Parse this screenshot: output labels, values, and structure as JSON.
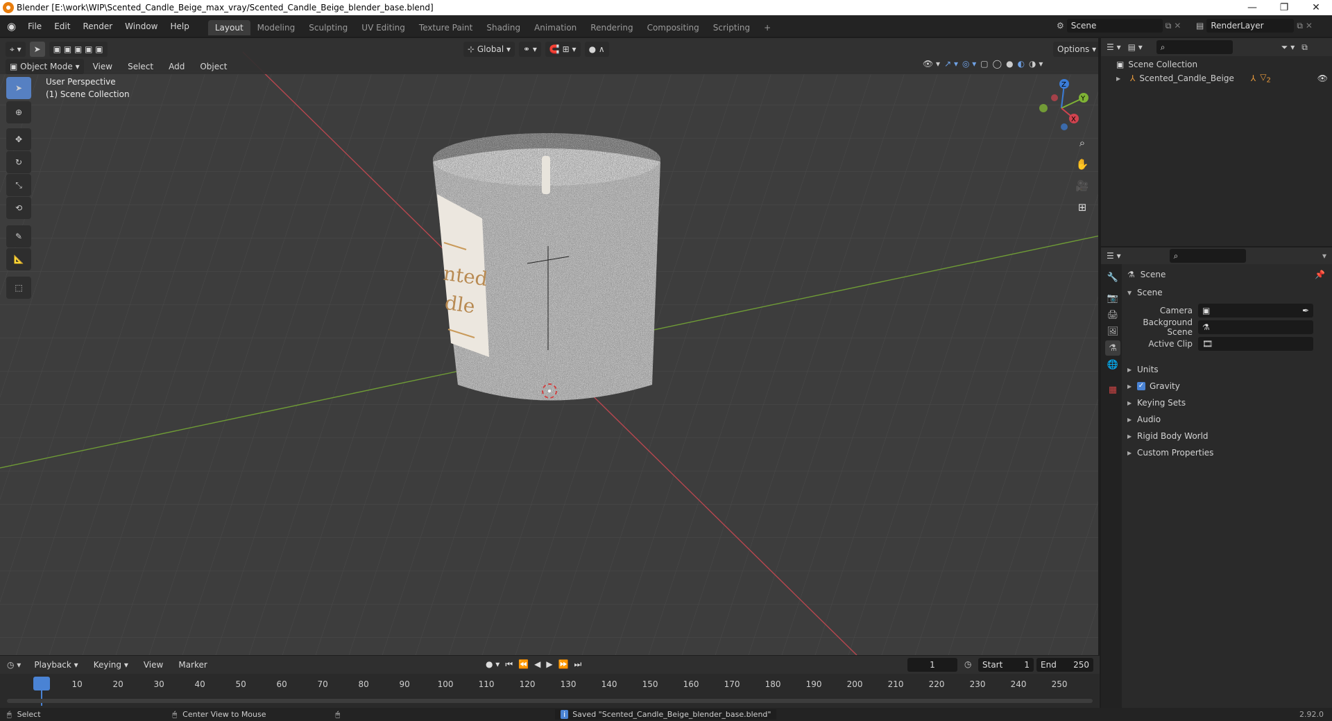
{
  "window": {
    "title": "Blender [E:\\work\\WIP\\Scented_Candle_Beige_max_vray/Scented_Candle_Beige_blender_base.blend]",
    "minimize": "—",
    "maximize": "❐",
    "close": "✕"
  },
  "menu": [
    "File",
    "Edit",
    "Render",
    "Window",
    "Help"
  ],
  "workspaces": [
    "Layout",
    "Modeling",
    "Sculpting",
    "UV Editing",
    "Texture Paint",
    "Shading",
    "Animation",
    "Rendering",
    "Compositing",
    "Scripting"
  ],
  "workspace_add": "+",
  "scene_field": "Scene",
  "renderlayer_field": "RenderLayer",
  "viewport": {
    "mode": "Object Mode",
    "menus": [
      "View",
      "Select",
      "Add",
      "Object"
    ],
    "transform_orientation": "Global",
    "options": "Options",
    "overlay_line1": "User Perspective",
    "overlay_line2": "(1) Scene Collection",
    "label_text1": "nted",
    "label_text2": "dle",
    "gizmo": {
      "z": "Z",
      "y": "Y",
      "x": "X"
    }
  },
  "outliner": {
    "root": "Scene Collection",
    "items": [
      {
        "label": "Scented_Candle_Beige",
        "badge": "2"
      }
    ]
  },
  "properties": {
    "context_title": "Scene",
    "panel_title": "Scene",
    "fields": [
      {
        "label": "Camera",
        "value": ""
      },
      {
        "label": "Background Scene",
        "value": ""
      },
      {
        "label": "Active Clip",
        "value": ""
      }
    ],
    "panels": [
      "Units",
      "Gravity",
      "Keying Sets",
      "Audio",
      "Rigid Body World",
      "Custom Properties"
    ],
    "gravity_checked": true
  },
  "timeline": {
    "menus": [
      "Playback",
      "Keying",
      "View",
      "Marker"
    ],
    "current_frame": "1",
    "start_label": "Start",
    "start_value": "1",
    "end_label": "End",
    "end_value": "250",
    "ticks": [
      "1",
      "10",
      "20",
      "30",
      "40",
      "50",
      "60",
      "70",
      "80",
      "90",
      "100",
      "110",
      "120",
      "130",
      "140",
      "150",
      "160",
      "170",
      "180",
      "190",
      "200",
      "210",
      "220",
      "230",
      "240",
      "250"
    ]
  },
  "status": {
    "left": "Select",
    "middle": "Center View to Mouse",
    "message": "Saved \"Scented_Candle_Beige_blender_base.blend\"",
    "version": "2.92.0"
  },
  "colors": {
    "accent": "#5680c2",
    "x_axis": "#d0434f",
    "y_axis": "#7fb335",
    "z_axis": "#3b7dd8",
    "frame": "#4a83d4"
  }
}
